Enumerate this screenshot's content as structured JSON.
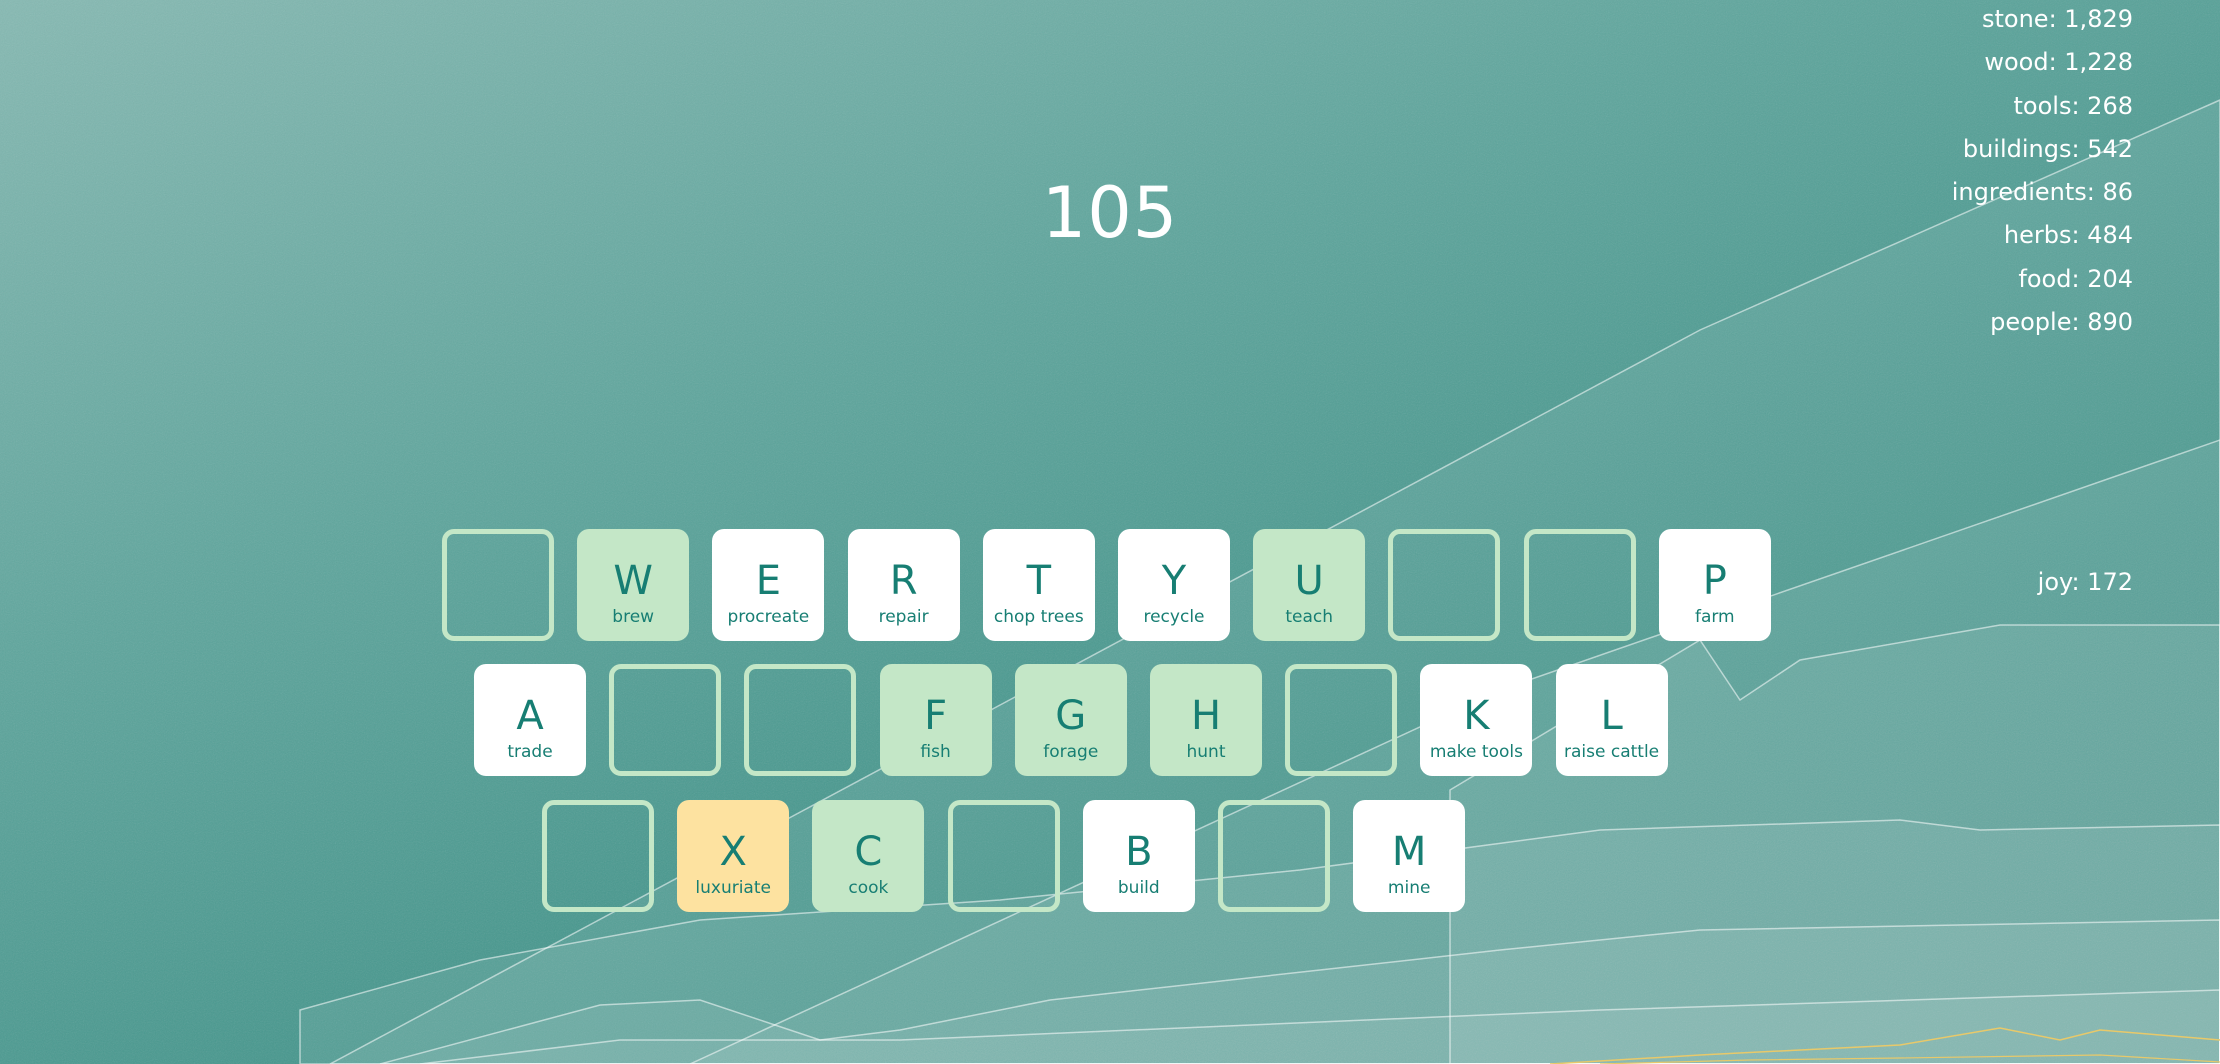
{
  "score": "105",
  "resources": [
    {
      "label": "stone: 1,829"
    },
    {
      "label": "wood: 1,228"
    },
    {
      "label": "tools: 268"
    },
    {
      "label": "buildings: 542"
    },
    {
      "label": "ingredients: 86"
    },
    {
      "label": "herbs: 484"
    },
    {
      "label": "food: 204"
    },
    {
      "label": "people: 890"
    }
  ],
  "joy": "joy: 172",
  "colors": {
    "key_white": "#ffffff",
    "key_green": "#c4e7c7",
    "key_yellow": "#fde2a0",
    "key_text": "#177e73"
  },
  "keyboard": {
    "row1": [
      {
        "state": "empty"
      },
      {
        "letter": "W",
        "action": "brew",
        "state": "green"
      },
      {
        "letter": "E",
        "action": "procreate",
        "state": "white"
      },
      {
        "letter": "R",
        "action": "repair",
        "state": "white"
      },
      {
        "letter": "T",
        "action": "chop trees",
        "state": "white"
      },
      {
        "letter": "Y",
        "action": "recycle",
        "state": "white"
      },
      {
        "letter": "U",
        "action": "teach",
        "state": "green"
      },
      {
        "state": "empty"
      },
      {
        "state": "empty"
      },
      {
        "letter": "P",
        "action": "farm",
        "state": "white"
      }
    ],
    "row2": [
      {
        "letter": "A",
        "action": "trade",
        "state": "white"
      },
      {
        "state": "empty"
      },
      {
        "state": "empty"
      },
      {
        "letter": "F",
        "action": "fish",
        "state": "green"
      },
      {
        "letter": "G",
        "action": "forage",
        "state": "green"
      },
      {
        "letter": "H",
        "action": "hunt",
        "state": "green"
      },
      {
        "state": "empty"
      },
      {
        "letter": "K",
        "action": "make tools",
        "state": "white"
      },
      {
        "letter": "L",
        "action": "raise cattle",
        "state": "white"
      }
    ],
    "row3": [
      {
        "state": "empty"
      },
      {
        "letter": "X",
        "action": "luxuriate",
        "state": "yellow"
      },
      {
        "letter": "C",
        "action": "cook",
        "state": "green"
      },
      {
        "state": "empty"
      },
      {
        "letter": "B",
        "action": "build",
        "state": "white"
      },
      {
        "state": "empty"
      },
      {
        "letter": "M",
        "action": "mine",
        "state": "white"
      }
    ]
  }
}
